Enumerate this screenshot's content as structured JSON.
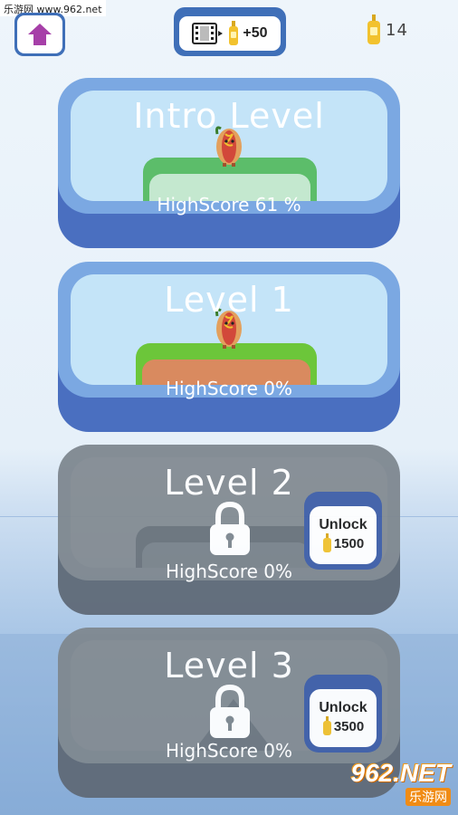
{
  "watermark_top": "乐游网 www.962.net",
  "coins": {
    "count": "14"
  },
  "ad_button": {
    "reward": "+50"
  },
  "levels": [
    {
      "title": "Intro Level",
      "score": "HighScore 61 %",
      "locked": false
    },
    {
      "title": "Level 1",
      "score": "HighScore 0%",
      "locked": false
    },
    {
      "title": "Level 2",
      "score": "HighScore 0%",
      "locked": true,
      "unlock_label": "Unlock",
      "unlock_price": "1500"
    },
    {
      "title": "Level 3",
      "score": "HighScore 0%",
      "locked": true,
      "unlock_label": "Unlock",
      "unlock_price": "3500"
    }
  ],
  "watermark_bottom": {
    "big": "962.NET",
    "small": "乐游网"
  },
  "colors": {
    "accent_blue": "#3f6fb8",
    "card_rim": "#7ba8e2",
    "home_arrow": "#a63fa8",
    "mustard": "#f2c22e",
    "grass_green": "#6cc63a",
    "locked_gray": "#7f8890"
  },
  "icons": [
    "home-icon",
    "video-icon",
    "mustard-bottle-icon",
    "padlock-icon",
    "hotdog-character"
  ]
}
